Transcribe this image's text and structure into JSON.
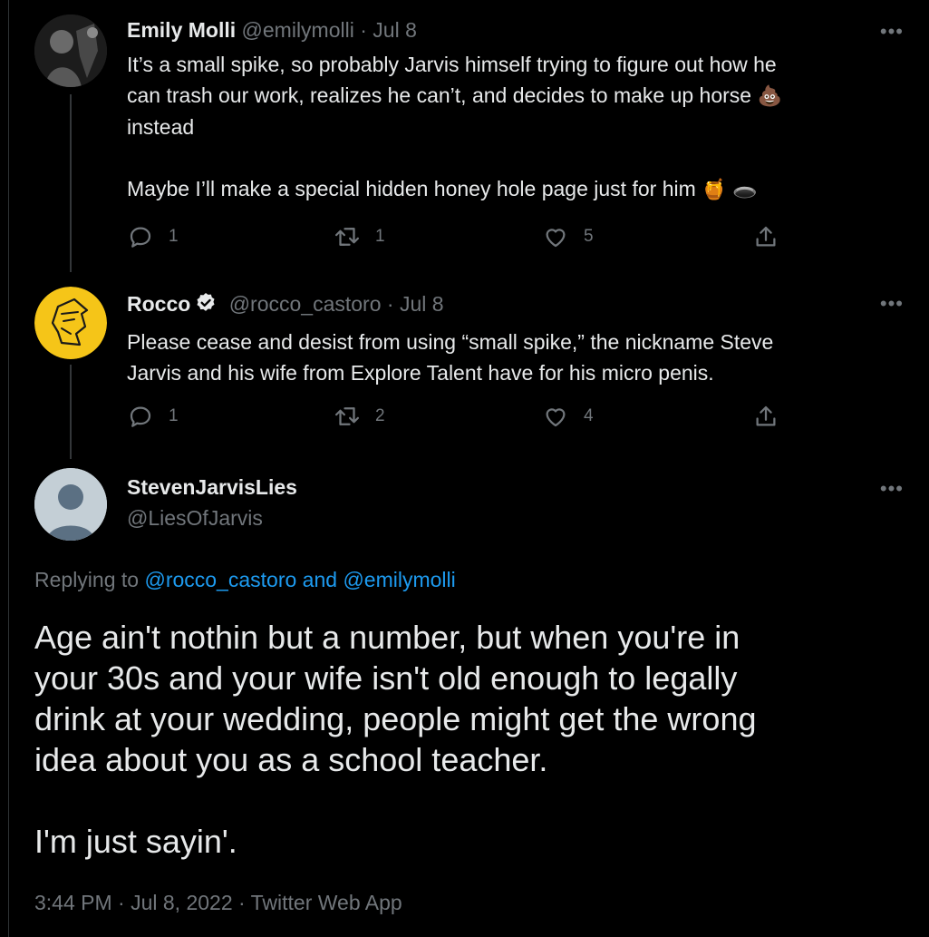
{
  "tweets": [
    {
      "name": "Emily Molli",
      "handle": "@emilymolli",
      "separator": "·",
      "date": "Jul 8",
      "text_lines": [
        "It’s a small spike, so probably Jarvis himself trying to figure out how he",
        "can trash our work, realizes he can’t, and decides to make up horse",
        "instead"
      ],
      "emoji_poop": "💩",
      "text_line2": "Maybe I’ll make a special hidden honey hole page just for him",
      "emoji_honey": "🍯",
      "emoji_hole": "🕳️",
      "reply_count": "1",
      "retweet_count": "1",
      "like_count": "5",
      "more": "•••"
    },
    {
      "name": "Rocco",
      "handle": "@rocco_castoro",
      "separator": "·",
      "date": "Jul 8",
      "text_lines": [
        "Please cease and desist from using “small spike,” the nickname Steve",
        "Jarvis and his wife from Explore Talent have for his micro penis."
      ],
      "reply_count": "1",
      "retweet_count": "2",
      "like_count": "4",
      "more": "•••",
      "avatar_color": "#f5c518"
    }
  ],
  "main": {
    "name": "StevenJarvisLies",
    "handle": "@LiesOfJarvis",
    "more": "•••",
    "replying_prefix": "Replying to",
    "replying_handle1": "@rocco_castoro",
    "replying_and": "and",
    "replying_handle2": "@emilymolli",
    "text_lines": [
      "Age ain't nothin but a number, but when you're in",
      "your 30s and your wife isn't old enough to legally",
      "drink at your wedding, people might get the wrong",
      "idea about you as a school teacher."
    ],
    "text_last": "I'm just sayin'.",
    "meta": "3:44 PM · Jul 8, 2022 · Twitter Web App"
  },
  "colors": {
    "background": "#000000",
    "text": "#e7e9ea",
    "secondary": "#71767b",
    "link": "#1d9bf0",
    "verified": "#e7e9ea"
  }
}
